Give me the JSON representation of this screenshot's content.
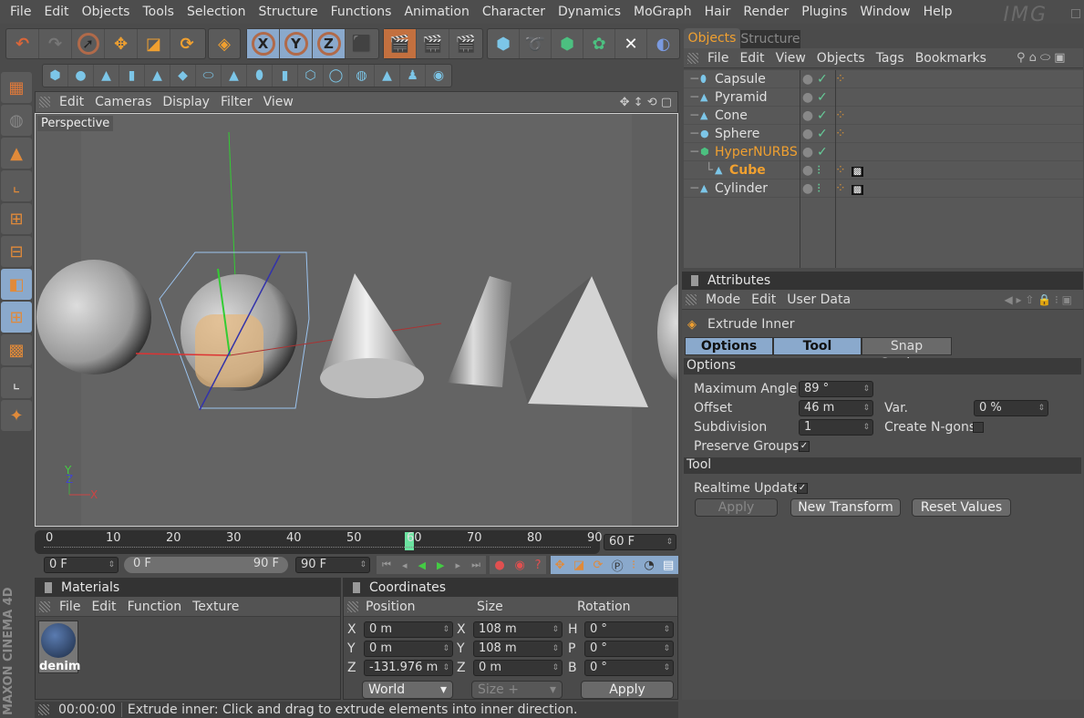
{
  "menu": [
    "File",
    "Edit",
    "Objects",
    "Tools",
    "Selection",
    "Structure",
    "Functions",
    "Animation",
    "Character",
    "Dynamics",
    "MoGraph",
    "Hair",
    "Render",
    "Plugins",
    "Window",
    "Help"
  ],
  "logo": "IMG",
  "toolbar": {
    "axis_x": "X",
    "axis_y": "Y",
    "axis_z": "Z"
  },
  "viewport": {
    "menu": [
      "Edit",
      "Cameras",
      "Display",
      "Filter",
      "View"
    ],
    "camera_label": "Perspective",
    "axis_labels": {
      "x": "X",
      "y": "Y",
      "z": "Z"
    }
  },
  "timeline": {
    "ticks": [
      "0",
      "10",
      "20",
      "30",
      "40",
      "50",
      "60",
      "70",
      "80",
      "90"
    ],
    "current_frame": "60",
    "end_field": "60 F",
    "start_field": "0 F",
    "range_start": "0 F",
    "range_end": "90 F",
    "max_field": "90 F"
  },
  "objects_panel": {
    "tabs": [
      "Objects",
      "Structure"
    ],
    "menu": [
      "File",
      "Edit",
      "View",
      "Objects",
      "Tags",
      "Bookmarks"
    ],
    "items": [
      {
        "name": "Capsule",
        "icon": "capsule",
        "enabled": true,
        "tags": [
          "material"
        ]
      },
      {
        "name": "Pyramid",
        "icon": "pyramid",
        "enabled": true,
        "tags": []
      },
      {
        "name": "Cone",
        "icon": "cone",
        "enabled": true,
        "tags": [
          "material"
        ]
      },
      {
        "name": "Sphere",
        "icon": "sphere",
        "enabled": true,
        "tags": [
          "material"
        ]
      },
      {
        "name": "HyperNURBS",
        "icon": "hypernurbs",
        "enabled": true,
        "tags": [],
        "highlight": true
      },
      {
        "name": "Cube",
        "icon": "polygon",
        "enabled": false,
        "tags": [
          "material",
          "texture"
        ],
        "highlight": true,
        "child": true
      },
      {
        "name": "Cylinder",
        "icon": "polygon",
        "enabled": false,
        "tags": [
          "material",
          "texture"
        ]
      }
    ]
  },
  "attributes": {
    "title": "Attributes",
    "menu": [
      "Mode",
      "Edit",
      "User Data"
    ],
    "tool_name": "Extrude Inner",
    "tabs": [
      "Options",
      "Tool",
      "Snap Settings"
    ],
    "options_header": "Options",
    "max_angle_label": "Maximum Angle",
    "max_angle": "89 °",
    "offset_label": "Offset",
    "offset": "46 m",
    "var_label": "Var.",
    "var": "0 %",
    "subdivision_label": "Subdivision",
    "subdivision": "1",
    "ngons_label": "Create N-gons",
    "ngons": false,
    "preserve_label": "Preserve Groups",
    "preserve": true,
    "tool_header": "Tool",
    "realtime_label": "Realtime Update",
    "realtime": true,
    "apply": "Apply",
    "new_transform": "New Transform",
    "reset": "Reset Values"
  },
  "materials": {
    "title": "Materials",
    "menu": [
      "File",
      "Edit",
      "Function",
      "Texture"
    ],
    "items": [
      {
        "name": "denim"
      }
    ]
  },
  "coordinates": {
    "title": "Coordinates",
    "headers": [
      "Position",
      "Size",
      "Rotation"
    ],
    "rows": [
      {
        "pl": "X",
        "p": "0 m",
        "sl": "X",
        "s": "108 m",
        "rl": "H",
        "r": "0 °"
      },
      {
        "pl": "Y",
        "p": "0 m",
        "sl": "Y",
        "s": "108 m",
        "rl": "P",
        "r": "0 °"
      },
      {
        "pl": "Z",
        "p": "-131.976 m",
        "sl": "Z",
        "s": "0 m",
        "rl": "B",
        "r": "0 °"
      }
    ],
    "space": "World",
    "size_mode": "Size +",
    "apply": "Apply"
  },
  "status": {
    "time": "00:00:00",
    "message": "Extrude inner: Click and drag to extrude elements into inner direction."
  },
  "brand": "MAXON CINEMA 4D"
}
